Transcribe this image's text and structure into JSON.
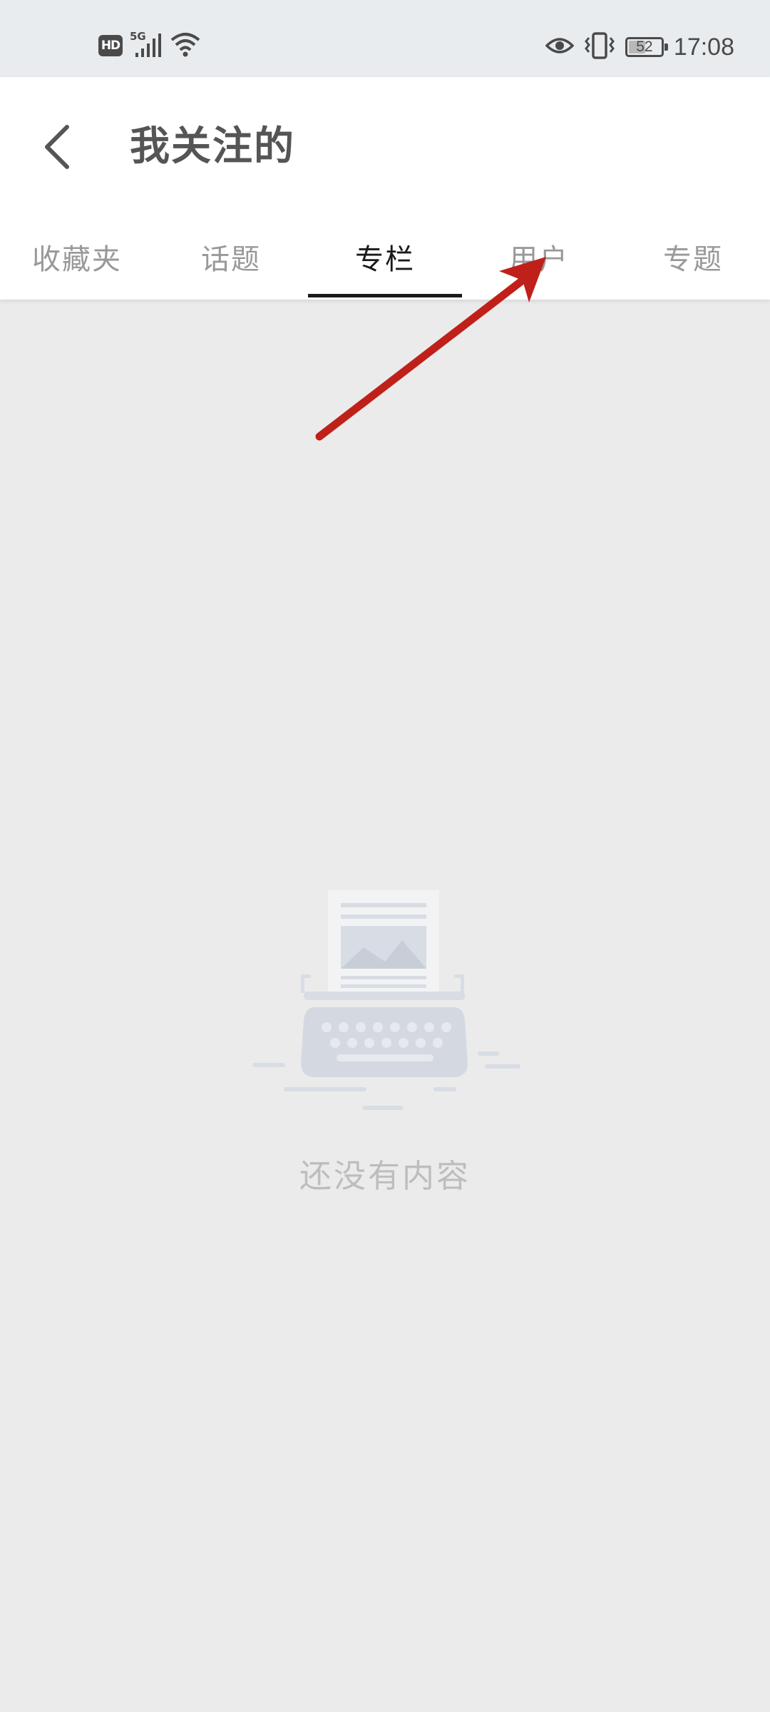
{
  "status_bar": {
    "network_badge": "HD",
    "network_type": "5G",
    "battery_level": 52,
    "battery_text": "52",
    "time": "17:08",
    "icons": [
      "hd-icon",
      "signal-icon",
      "wifi-icon",
      "eye-icon",
      "vibrate-icon",
      "battery-icon"
    ]
  },
  "header": {
    "title": "我关注的"
  },
  "tabs": [
    {
      "label": "收藏夹",
      "active": false
    },
    {
      "label": "话题",
      "active": false
    },
    {
      "label": "专栏",
      "active": true
    },
    {
      "label": "用户",
      "active": false
    },
    {
      "label": "专题",
      "active": false
    }
  ],
  "empty_state": {
    "text": "还没有内容",
    "icon": "typewriter-icon"
  },
  "annotation": {
    "type": "arrow",
    "color": "#c0201a",
    "points_to": "用户"
  }
}
